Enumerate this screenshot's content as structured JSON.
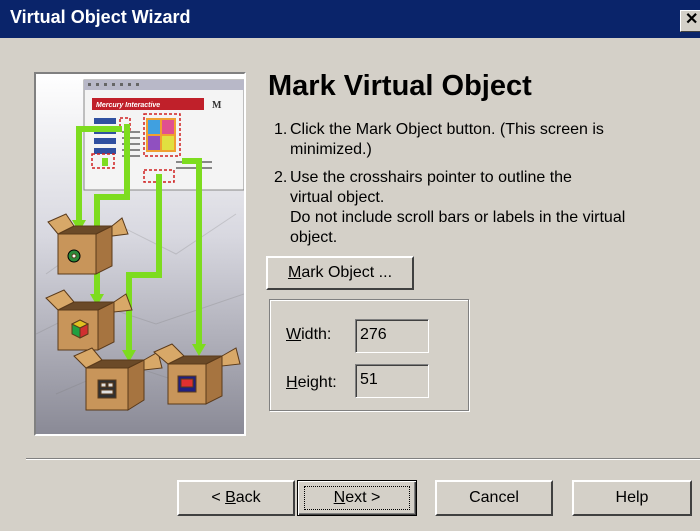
{
  "window": {
    "title": "Virtual Object Wizard",
    "close_glyph": "✕"
  },
  "heading": "Mark Virtual Object",
  "steps": [
    {
      "num": "1.",
      "lines": [
        "Click the Mark Object button. (This screen is",
        "minimized.)"
      ]
    },
    {
      "num": "2.",
      "lines": [
        "Use the crosshairs pointer to outline the",
        "virtual object.",
        "Do not include scroll bars or labels in the virtual",
        "object."
      ]
    }
  ],
  "mark_button": {
    "pre": "",
    "mnemonic": "M",
    "post": "ark Object ..."
  },
  "dimensions": {
    "width": {
      "mnemonic": "W",
      "rest": "idth:",
      "value": "276"
    },
    "height": {
      "mnemonic": "H",
      "rest": "eight:",
      "value": "51"
    }
  },
  "illustration": {
    "banner": "Mercury Interactive",
    "logo": "M"
  },
  "footer": {
    "back": {
      "pre": "< ",
      "mnemonic": "B",
      "post": "ack"
    },
    "next": {
      "pre": "",
      "mnemonic": "N",
      "post": "ext >"
    },
    "cancel": "Cancel",
    "help": "Help"
  },
  "colors": {
    "titlebar": "#0a246a",
    "face": "#d4d0c8",
    "arrow": "#7ddc1f",
    "box": "#c8955a"
  }
}
